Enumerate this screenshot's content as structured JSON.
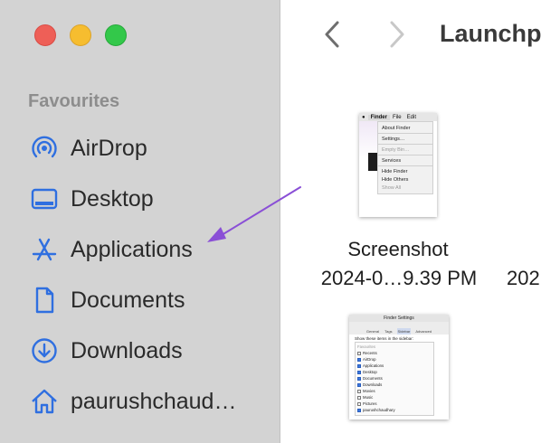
{
  "sidebar": {
    "section_title": "Favourites",
    "items": [
      {
        "label": "AirDrop",
        "icon": "airdrop-icon"
      },
      {
        "label": "Desktop",
        "icon": "desktop-icon"
      },
      {
        "label": "Applications",
        "icon": "applications-icon"
      },
      {
        "label": "Documents",
        "icon": "document-icon"
      },
      {
        "label": "Downloads",
        "icon": "download-icon"
      },
      {
        "label": "paurushchaud…",
        "icon": "home-icon"
      }
    ]
  },
  "toolbar": {
    "title": "Launchp",
    "back_icon": "chevron-left-icon",
    "forward_icon": "chevron-right-icon"
  },
  "files": [
    {
      "name_line1": "Screenshot",
      "name_line2": "2024-0…9.39 PM"
    },
    {
      "name_line2": "202"
    }
  ],
  "thumb1": {
    "menubar": [
      "Finder",
      "File",
      "Edit"
    ],
    "menu": [
      "About Finder",
      "Settings…",
      "Empty Bin…",
      "Services",
      "Hide Finder",
      "Hide Others",
      "Show All"
    ]
  },
  "thumb2": {
    "title": "Finder Settings",
    "tabs": [
      "General",
      "Tags",
      "Sidebar",
      "Advanced"
    ],
    "caption": "Show these items in the sidebar:",
    "group": "Favourites",
    "items": [
      "Recents",
      "AirDrop",
      "Applications",
      "Desktop",
      "Documents",
      "Downloads",
      "Movies",
      "Music",
      "Pictures",
      "paurushchaudhary"
    ]
  },
  "colors": {
    "accent": "#2f6fe0",
    "arrow": "#8a4fd6",
    "sidebar_bg": "#d3d3d3"
  }
}
